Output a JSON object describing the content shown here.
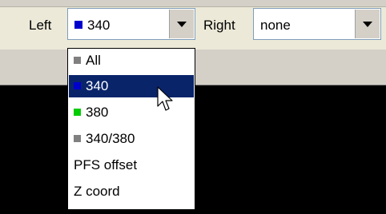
{
  "toolbar": {
    "left": {
      "label": "Left",
      "value": "340",
      "swatch": "#0000cc"
    },
    "right": {
      "label": "Right",
      "value": "none"
    }
  },
  "dropdown": {
    "items": [
      {
        "label": "All",
        "swatch": "#808080"
      },
      {
        "label": "340",
        "swatch": "#0000cc",
        "selected": true
      },
      {
        "label": "380",
        "swatch": "#00cc00"
      },
      {
        "label": "340/380",
        "swatch": "#808080"
      },
      {
        "label": "PFS offset"
      },
      {
        "label": "Z coord"
      }
    ]
  },
  "icons": {
    "dropdown_arrow": "chevron-down-icon",
    "cursor": "mouse-pointer-icon"
  }
}
